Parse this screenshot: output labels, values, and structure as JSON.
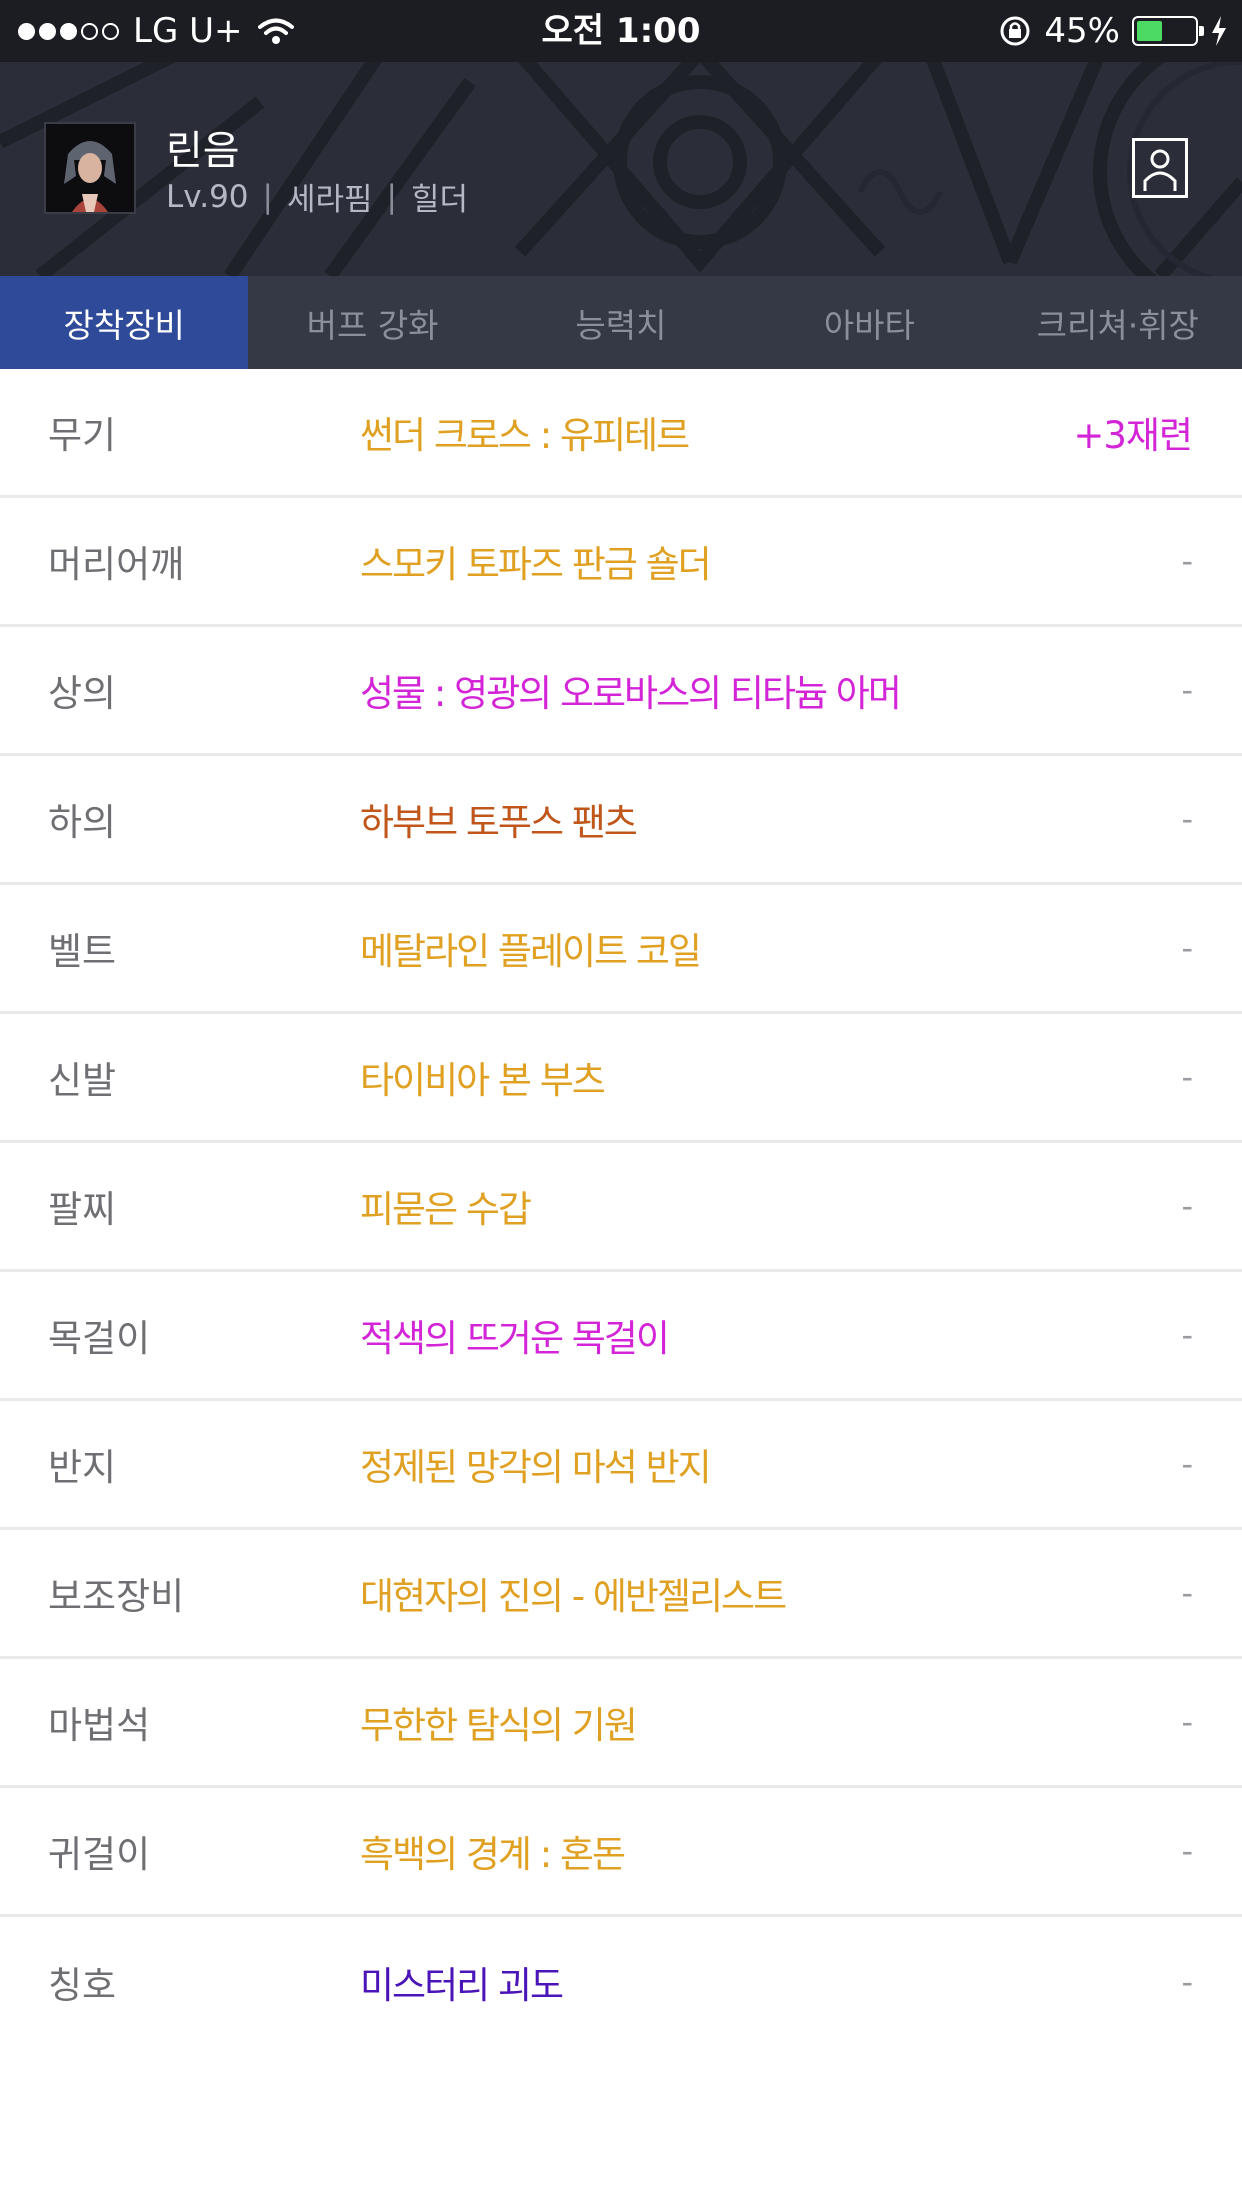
{
  "status_bar": {
    "carrier": "LG U+",
    "time": "오전 1:00",
    "battery_percent": "45%",
    "battery_level": 0.45,
    "signal_bars_filled": 3,
    "signal_bars_total": 5
  },
  "profile": {
    "name": "린음",
    "level": "Lv.90",
    "server": "세라핌",
    "job": "힐더",
    "separator": "|"
  },
  "tabs": [
    {
      "label": "장착장비",
      "active": true
    },
    {
      "label": "버프 강화",
      "active": false
    },
    {
      "label": "능력치",
      "active": false
    },
    {
      "label": "아바타",
      "active": false
    },
    {
      "label": "크리쳐·휘장",
      "active": false
    }
  ],
  "equipment": [
    {
      "slot": "무기",
      "item": "썬더 크로스 : 유피테르",
      "color": "#e0a021",
      "enhance": "+3재련",
      "enhance_color": "#d424d8"
    },
    {
      "slot": "머리어깨",
      "item": "스모키 토파즈 판금 숄더",
      "color": "#e0a021",
      "enhance": "-",
      "enhance_color": "#9a9a9f"
    },
    {
      "slot": "상의",
      "item": "성물 : 영광의 오로바스의 티타늄 아머",
      "color": "#d424d8",
      "enhance": "-",
      "enhance_color": "#9a9a9f"
    },
    {
      "slot": "하의",
      "item": "하부브 토푸스 팬츠",
      "color": "#c0561a",
      "enhance": "-",
      "enhance_color": "#9a9a9f"
    },
    {
      "slot": "벨트",
      "item": "메탈라인 플레이트 코일",
      "color": "#e0a021",
      "enhance": "-",
      "enhance_color": "#9a9a9f"
    },
    {
      "slot": "신발",
      "item": "타이비아 본 부츠",
      "color": "#e0a021",
      "enhance": "-",
      "enhance_color": "#9a9a9f"
    },
    {
      "slot": "팔찌",
      "item": "피묻은 수갑",
      "color": "#e0a021",
      "enhance": "-",
      "enhance_color": "#9a9a9f"
    },
    {
      "slot": "목걸이",
      "item": "적색의 뜨거운 목걸이",
      "color": "#d424d8",
      "enhance": "-",
      "enhance_color": "#9a9a9f"
    },
    {
      "slot": "반지",
      "item": "정제된 망각의 마석 반지",
      "color": "#e0a021",
      "enhance": "-",
      "enhance_color": "#9a9a9f"
    },
    {
      "slot": "보조장비",
      "item": "대현자의 진의 - 에반젤리스트",
      "color": "#e0a021",
      "enhance": "-",
      "enhance_color": "#9a9a9f"
    },
    {
      "slot": "마법석",
      "item": "무한한 탐식의 기원",
      "color": "#e0a021",
      "enhance": "-",
      "enhance_color": "#9a9a9f"
    },
    {
      "slot": "귀걸이",
      "item": "흑백의 경계 : 혼돈",
      "color": "#e0a021",
      "enhance": "-",
      "enhance_color": "#9a9a9f"
    },
    {
      "slot": "칭호",
      "item": "미스터리 괴도",
      "color": "#4b14b8",
      "enhance": "-",
      "enhance_color": "#9a9a9f"
    }
  ]
}
